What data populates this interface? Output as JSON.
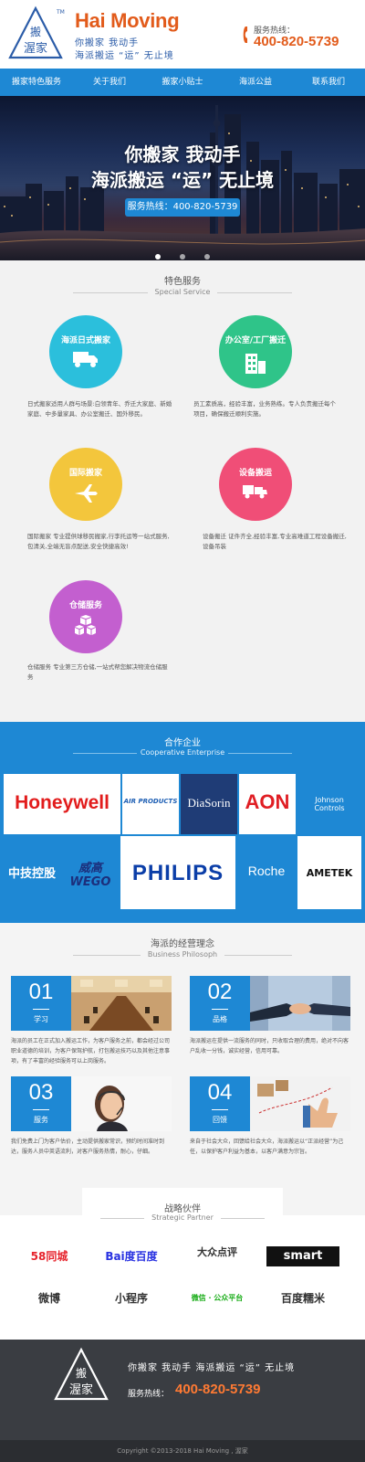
{
  "header": {
    "brand": "Hai Moving",
    "tm": "TM",
    "logo_text_top": "搬",
    "logo_text_bottom": "渥家",
    "slogan_line1": "你搬家   我动手",
    "slogan_line2": "海派搬运 “运” 无止境",
    "hotline_label": "服务热线：",
    "hotline_number": "400-820-5739",
    "accent": "#e25b1b",
    "brand_blue": "#2b5ca8"
  },
  "nav": {
    "items": [
      {
        "label": "搬家特色服务"
      },
      {
        "label": "关于我们"
      },
      {
        "label": "搬家小贴士"
      },
      {
        "label": "海派公益"
      },
      {
        "label": "联系我们"
      }
    ],
    "color": "#1e88d4"
  },
  "banner": {
    "title_line1": "你搬家 我动手",
    "title_line2": "海派搬运 “运” 无止境",
    "button": "服务热线：400-820-5739"
  },
  "special_service": {
    "title": "特色服务",
    "subtitle": "Special Service",
    "items": [
      {
        "label": "海派日式搬家",
        "icon": "truck-icon",
        "color": "#2bbfdc",
        "desc": "日式搬家适用人群与场景:白领青年、乔迁大家庭、新婚家庭、中多量家具、办公室搬迁、国外移民。"
      },
      {
        "label": "办公室/工厂搬迁",
        "icon": "building-icon",
        "color": "#2fc489",
        "desc": "员工素质高，经验丰富，业务熟练。专人负责搬迁每个项目，确保搬迁顺利实施。"
      },
      {
        "label": "国际搬家",
        "icon": "plane-icon",
        "color": "#f3c63c",
        "desc": "国际搬家 专业提供球移民搬家,行李托运等一站式服务,包清关,全端无盲点配送,安全快捷高效!"
      },
      {
        "label": "设备搬运",
        "icon": "delivery-icon",
        "color": "#f04e77",
        "desc": "设备搬迁 证件齐全,经验丰富,专业高难道工程设备搬迁,设备吊装"
      },
      {
        "label": "仓储服务",
        "icon": "boxes-icon",
        "color": "#c35fcf",
        "desc": "仓储服务 专业第三方仓储,一站式帮您解决物流仓储服务"
      }
    ]
  },
  "cooperative": {
    "title": "合作企业",
    "subtitle": "Cooperative Enterprise",
    "logos": [
      "Honeywell",
      "AIR PRODUCTS",
      "DiaSorin",
      "AON",
      "Johnson Controls",
      "中技控股",
      "威高 WEGO",
      "PHILIPS",
      "Roche",
      "AMETEK"
    ]
  },
  "philosophy": {
    "title": "海派的经营理念",
    "subtitle": "Business Philosoph",
    "items": [
      {
        "num": "01",
        "label": "学习",
        "desc": "海派的员工在正式加入搬运工作，为客户服务之前，都会经过公司职业道德的培训，为客户保驾护航，打包搬运技巧以及其他注意事项，有了丰富的经验服务可以上岗服务。"
      },
      {
        "num": "02",
        "label": "品格",
        "desc": "海派搬运在提供一流服务的同时，只收取合理的费用，绝对不向客户乱收一分钱，诚实经营，信用可靠。"
      },
      {
        "num": "03",
        "label": "服务",
        "desc": "我们免费上门为客户估价，主动提供搬家常识，预约时间准时到达，服务人员中英语流利，对客户服务热情，耐心，仔细。"
      },
      {
        "num": "04",
        "label": "回馈",
        "desc": "来自于社会大众，回馈给社会大众，海派搬运以“正派经营”为己任，以保护客户利益为基本，以客户满意为宗旨。"
      }
    ]
  },
  "partners": {
    "title": "战略伙伴",
    "subtitle": "Strategic Partner",
    "items": [
      {
        "name": "58同城",
        "color": "#e6232c"
      },
      {
        "name": "Bai度百度",
        "color": "#2932e1"
      },
      {
        "name": "大众点评",
        "color": "#333333"
      },
      {
        "name": "smart",
        "color": "#111111"
      },
      {
        "name": "微博",
        "color": "#333333"
      },
      {
        "name": "小程序",
        "color": "#333333"
      },
      {
        "name": "微信 · 公众平台",
        "color": "#1aad19"
      },
      {
        "name": "百度糯米",
        "color": "#333333"
      }
    ]
  },
  "footer": {
    "slogan": "你搬家   我动手 海派搬运 “运” 无止境",
    "hotline_label": "服务热线：",
    "hotline_number": "400-820-5739",
    "copyright": "Copyright ©2013-2018  Hai Moving , 渥家"
  }
}
